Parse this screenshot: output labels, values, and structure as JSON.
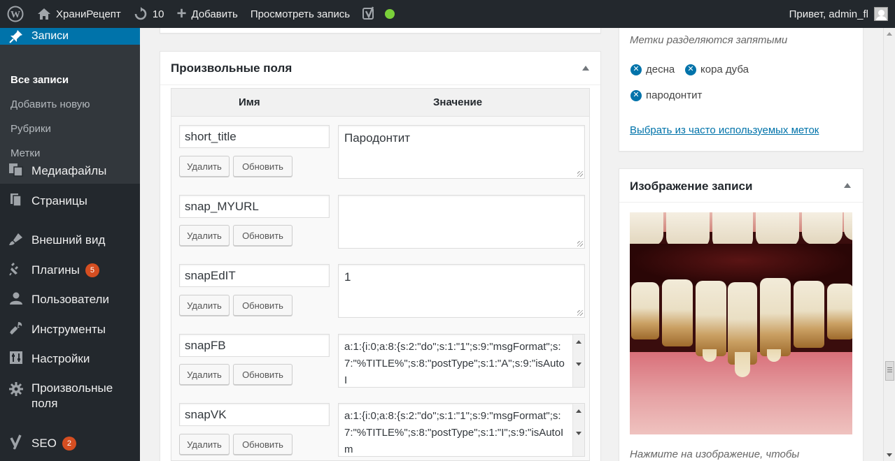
{
  "adminbar": {
    "site_name": "ХраниРецепт",
    "updates_count": "10",
    "add_new": "Добавить",
    "view_post": "Просмотреть запись",
    "greeting": "Привет, admin_fl"
  },
  "sidebar": {
    "current": "Записи",
    "submenu": [
      "Все записи",
      "Добавить новую",
      "Рубрики",
      "Метки"
    ],
    "items": [
      {
        "label": "Медиафайлы",
        "icon": "media-icon"
      },
      {
        "label": "Страницы",
        "icon": "pages-icon"
      },
      {
        "label": "Внешний вид",
        "icon": "appearance-icon"
      },
      {
        "label": "Плагины",
        "icon": "plugins-icon",
        "badge": "5"
      },
      {
        "label": "Пользователи",
        "icon": "users-icon"
      },
      {
        "label": "Инструменты",
        "icon": "tools-icon"
      },
      {
        "label": "Настройки",
        "icon": "settings-icon"
      },
      {
        "label_line1": "Произвольные",
        "label_line2": "поля",
        "icon": "custom-fields-icon"
      },
      {
        "label": "SEO",
        "icon": "yoast-icon",
        "badge": "2"
      }
    ]
  },
  "custom_fields": {
    "title": "Произвольные поля",
    "col_name": "Имя",
    "col_value": "Значение",
    "delete_label": "Удалить",
    "update_label": "Обновить",
    "rows": [
      {
        "key": "short_title",
        "value": "Пародонтит"
      },
      {
        "key": "snap_MYURL",
        "value": ""
      },
      {
        "key": "snapEdIT",
        "value": "1"
      },
      {
        "key": "snapFB",
        "value": "a:1:{i:0;a:8:{s:2:\"do\";s:1:\"1\";s:9:\"msgFormat\";s:7:\"%TITLE%\";s:8:\"postType\";s:1:\"A\";s:9:\"isAutoI"
      },
      {
        "key": "snapVK",
        "value": "a:1:{i:0;a:8:{s:2:\"do\";s:1:\"1\";s:9:\"msgFormat\";s:7:\"%TITLE%\";s:8:\"postType\";s:1:\"I\";s:9:\"isAutoIm"
      }
    ]
  },
  "tags_box": {
    "hint": "Метки разделяются запятыми",
    "tags": [
      "десна",
      "кора дуба",
      "пародонтит"
    ],
    "choose_link": "Выбрать из часто используемых меток"
  },
  "featured_image": {
    "title": "Изображение записи",
    "caption": "Нажмите на изображение, чтобы"
  },
  "colors": {
    "adminbar": "#23282d",
    "accent": "#0073aa",
    "badge": "#d54e21",
    "status_ok": "#7ad03a"
  }
}
